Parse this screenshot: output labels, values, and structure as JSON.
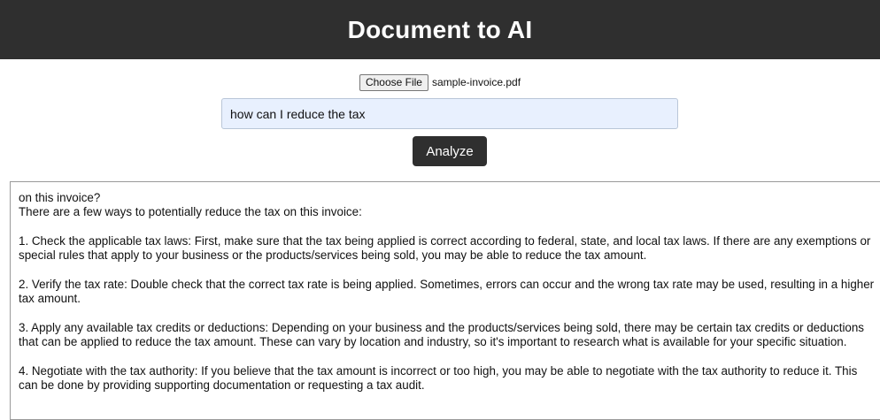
{
  "header": {
    "title": "Document to AI"
  },
  "file_picker": {
    "button_label": "Choose File",
    "file_name": "sample-invoice.pdf"
  },
  "query": {
    "value": "how can I reduce the tax"
  },
  "analyze_button": {
    "label": "Analyze"
  },
  "output": {
    "text": "on this invoice?\nThere are a few ways to potentially reduce the tax on this invoice:\n\n1. Check the applicable tax laws: First, make sure that the tax being applied is correct according to federal, state, and local tax laws. If there are any exemptions or special rules that apply to your business or the products/services being sold, you may be able to reduce the tax amount.\n\n2. Verify the tax rate: Double check that the correct tax rate is being applied. Sometimes, errors can occur and the wrong tax rate may be used, resulting in a higher tax amount.\n\n3. Apply any available tax credits or deductions: Depending on your business and the products/services being sold, there may be certain tax credits or deductions that can be applied to reduce the tax amount. These can vary by location and industry, so it's important to research what is available for your specific situation.\n\n4. Negotiate with the tax authority: If you believe that the tax amount is incorrect or too high, you may be able to negotiate with the tax authority to reduce it. This can be done by providing supporting documentation or requesting a tax audit."
  },
  "colors": {
    "header_bg": "#2f2f2f",
    "input_bg": "#e8f0fe",
    "button_bg": "#2f2f2f"
  }
}
